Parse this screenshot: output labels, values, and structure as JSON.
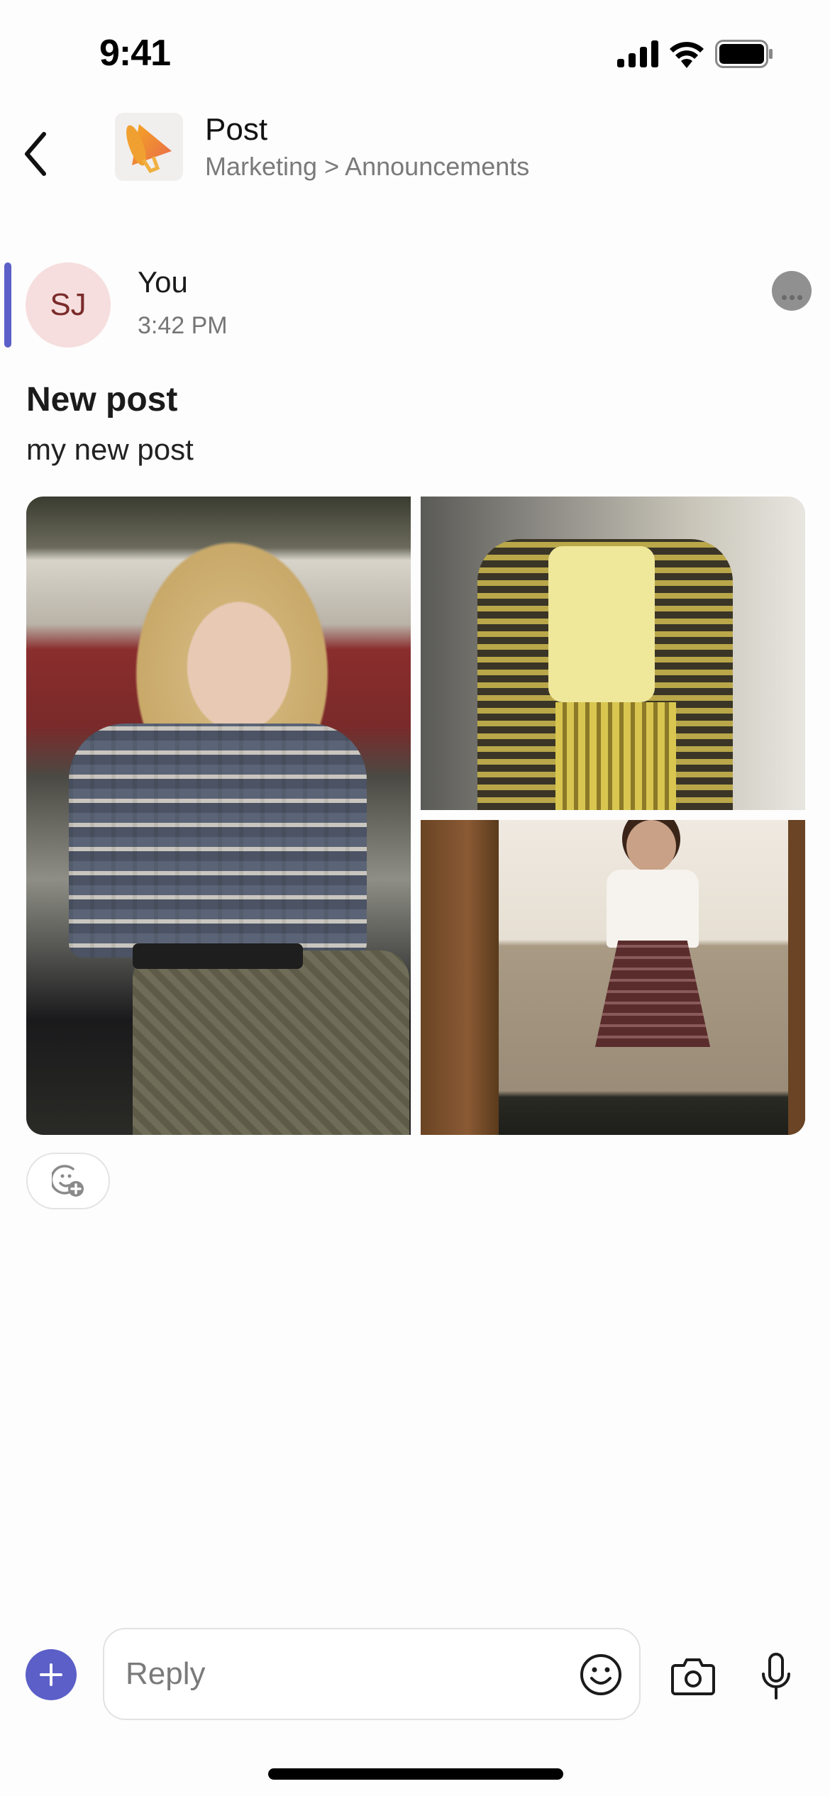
{
  "status_bar": {
    "time": "9:41",
    "icons": [
      "cellular-signal-icon",
      "wifi-icon",
      "battery-icon"
    ]
  },
  "header": {
    "back_icon": "chevron-left-icon",
    "channel_icon": "megaphone-icon",
    "title": "Post",
    "breadcrumb": "Marketing > Announcements"
  },
  "post": {
    "accent_color": "#5b5fc7",
    "avatar_initials": "SJ",
    "author": "You",
    "timestamp": "3:42 PM",
    "title": "New post",
    "body": "my new post",
    "images": [
      {
        "description": "Blonde woman in plaid crop top and olive skirt leaning on a car"
      },
      {
        "description": "Woman in yellow plaid blazer and skirt"
      },
      {
        "description": "Woman in white blouse and burgundy plaid skirt by a wooden door"
      }
    ],
    "reaction_icon": "add-reaction-icon"
  },
  "composer": {
    "add_icon": "plus-icon",
    "reply_placeholder": "Reply",
    "reply_value": "",
    "emoji_icon": "emoji-icon",
    "camera_icon": "camera-icon",
    "mic_icon": "microphone-icon"
  }
}
